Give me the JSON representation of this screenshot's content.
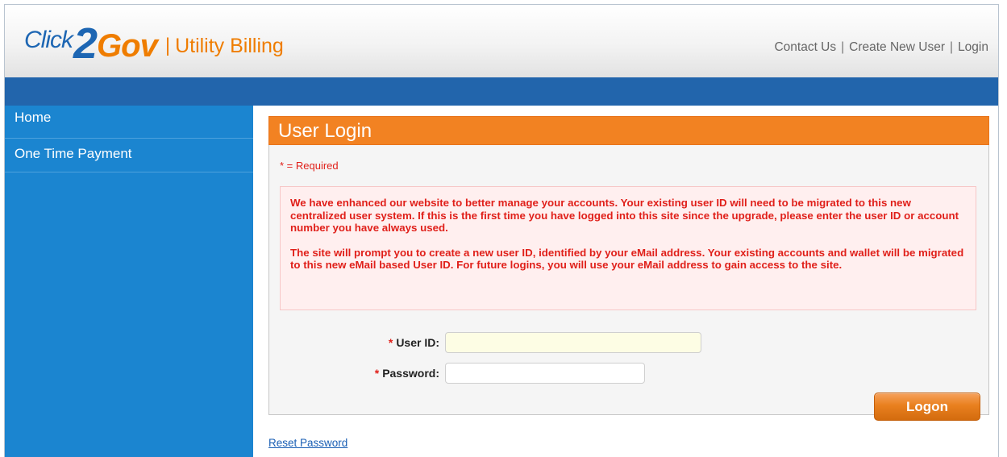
{
  "header": {
    "logo": {
      "click": "Click",
      "two": "2",
      "gov": "Gov",
      "separator": "|",
      "product": "Utility Billing"
    },
    "links": [
      {
        "label": "Contact Us"
      },
      {
        "label": "Create New User"
      },
      {
        "label": "Login"
      }
    ],
    "link_separator": "|"
  },
  "sidebar": {
    "items": [
      {
        "label": "Home"
      },
      {
        "label": "One Time Payment"
      }
    ]
  },
  "panel": {
    "title": "User Login",
    "required_note": "* = Required",
    "notice": [
      "We have enhanced our website to better manage your accounts. Your existing user ID will need to be migrated to this new centralized user system. If this is the first time you have logged into this site since the upgrade, please enter the user ID or account number you have always used.",
      "The site will prompt you to create a new user ID, identified by your eMail address. Your existing accounts and wallet will be migrated to this new eMail based User ID. For future logins, you will use your eMail address to gain access to the site."
    ],
    "fields": {
      "user_id": {
        "star": "*",
        "label": "User ID:",
        "value": ""
      },
      "password": {
        "star": "*",
        "label": "Password:",
        "value": ""
      }
    },
    "logon_label": "Logon"
  },
  "footer": {
    "reset_password": "Reset Password"
  },
  "colors": {
    "brand_blue": "#1d66b3",
    "brand_orange": "#ef7d00",
    "nav_bar": "#2265ac",
    "sidebar": "#1b85d0",
    "panel_header": "#f28222",
    "error_red": "#e0201a"
  }
}
